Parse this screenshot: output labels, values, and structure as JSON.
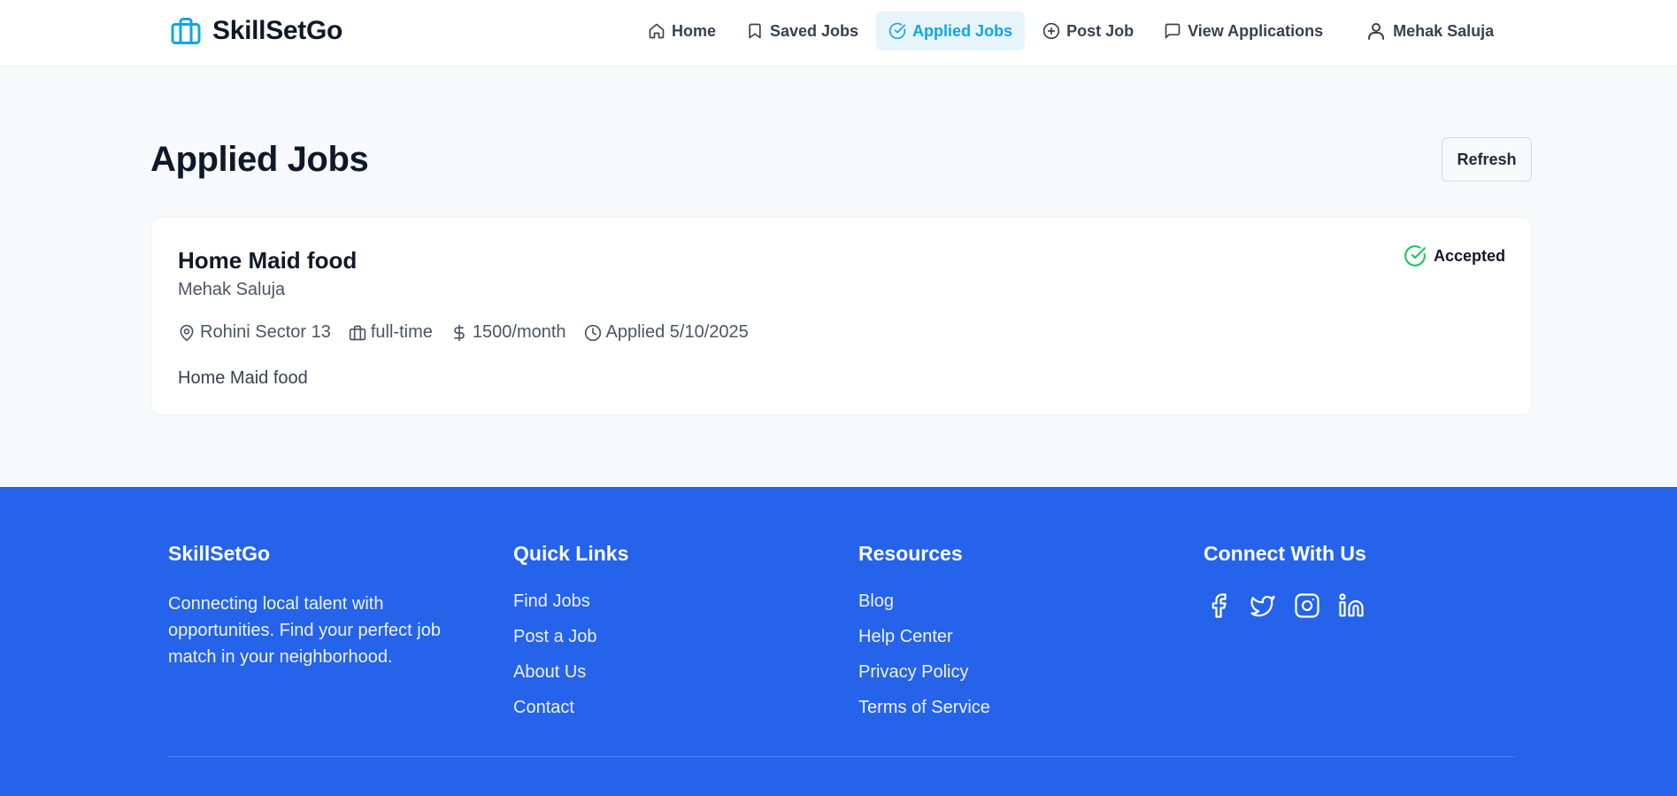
{
  "brand": {
    "name": "SkillSetGo",
    "icon": "briefcase-icon",
    "color": "#0ea5e9"
  },
  "nav": {
    "items": [
      {
        "label": "Home",
        "icon": "home-icon"
      },
      {
        "label": "Saved Jobs",
        "icon": "bookmark-icon"
      },
      {
        "label": "Applied Jobs",
        "icon": "check-circle-icon",
        "active": true
      },
      {
        "label": "Post Job",
        "icon": "plus-circle-icon"
      },
      {
        "label": "View Applications",
        "icon": "message-icon"
      }
    ],
    "user": {
      "name": "Mehak Saluja",
      "icon": "user-icon"
    },
    "active_color": "#0ea5e9"
  },
  "main": {
    "title": "Applied Jobs",
    "refresh_label": "Refresh"
  },
  "jobs": [
    {
      "title": "Home Maid food",
      "company": "Mehak Saluja",
      "location": "Rohini Sector 13",
      "type": "full-time",
      "salary": "1500/month",
      "applied": "Applied 5/10/2025",
      "description": "Home Maid food",
      "status": "Accepted",
      "status_color": "#22c55e"
    }
  ],
  "footer": {
    "background": "#2563eb",
    "about": {
      "heading": "SkillSetGo",
      "text": "Connecting local talent with opportunities. Find your perfect job match in your neighborhood."
    },
    "quick_links": {
      "heading": "Quick Links",
      "items": [
        "Find Jobs",
        "Post a Job",
        "About Us",
        "Contact"
      ]
    },
    "resources": {
      "heading": "Resources",
      "items": [
        "Blog",
        "Help Center",
        "Privacy Policy",
        "Terms of Service"
      ]
    },
    "connect": {
      "heading": "Connect With Us",
      "icons": [
        "facebook-icon",
        "twitter-icon",
        "instagram-icon",
        "linkedin-icon"
      ]
    }
  }
}
